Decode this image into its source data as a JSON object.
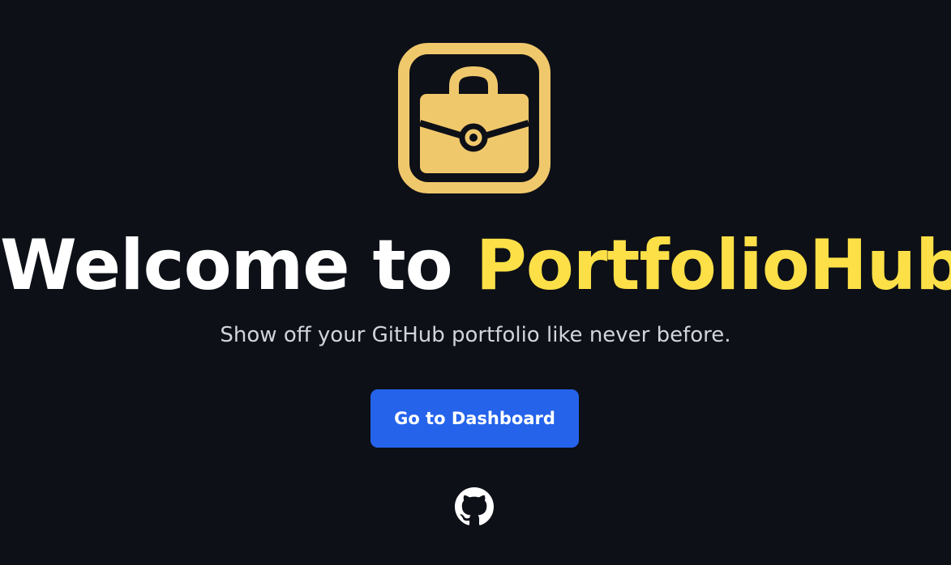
{
  "hero": {
    "headline_lead": "Welcome to",
    "headline_brand": "PortfolioHub",
    "subtitle": "Show off your GitHub portfolio like never before."
  },
  "cta": {
    "label": "Go to Dashboard"
  },
  "icons": {
    "logo": "briefcase-icon",
    "footer": "github-icon"
  },
  "colors": {
    "background": "#0d1017",
    "brand_yellow": "#fde047",
    "logo_gold": "#f0c86c",
    "button_blue": "#2563eb",
    "subtitle_gray": "#d1d5db"
  }
}
